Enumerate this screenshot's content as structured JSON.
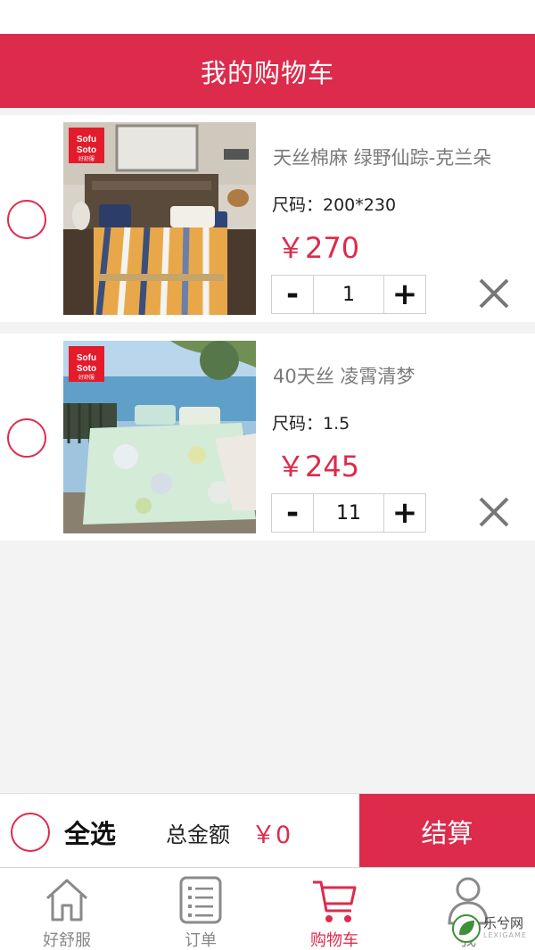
{
  "header": {
    "title": "我的购物车"
  },
  "cart_items": [
    {
      "title": "天丝棉麻 绿野仙踪-克兰朵",
      "size": "尺码：200*230",
      "price": "￥270",
      "quantity": "1",
      "minus_label": "-",
      "plus_label": "+",
      "brand_badge": "Sofu Soto 好舒服"
    },
    {
      "title": "40天丝 凌霄清梦",
      "size": "尺码：1.5",
      "price": "￥245",
      "quantity": "11",
      "minus_label": "-",
      "plus_label": "+",
      "brand_badge": "Sofu Soto 好舒服"
    }
  ],
  "checkout": {
    "select_all_label": "全选",
    "total_label": "总金额",
    "total_value": "￥0",
    "checkout_label": "结算"
  },
  "tab_bar": [
    {
      "label": "好舒服",
      "icon": "home-icon"
    },
    {
      "label": "订单",
      "icon": "order-list-icon"
    },
    {
      "label": "购物车",
      "icon": "cart-icon",
      "active": true
    },
    {
      "label": "我",
      "icon": "user-icon"
    }
  ],
  "watermark": {
    "text": "乐兮网",
    "sub": "LEXIGAME"
  },
  "colors": {
    "accent": "#dd2b4c",
    "background": "#f3f3f3",
    "inactive_tab": "#888888"
  }
}
